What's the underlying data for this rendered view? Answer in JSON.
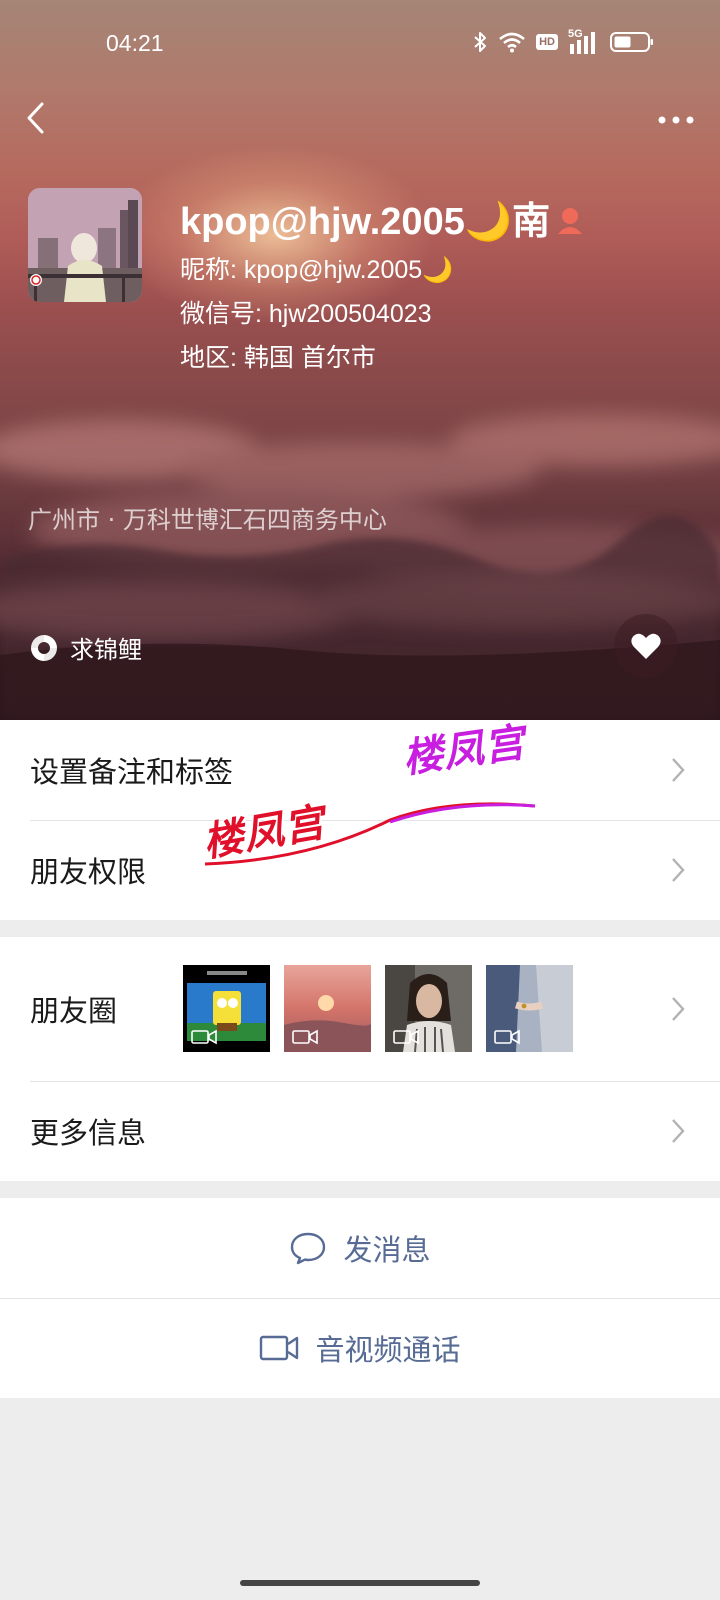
{
  "status_bar": {
    "time": "04:21",
    "hd_label": "HD",
    "network_label": "5G"
  },
  "profile": {
    "display_name": "kpop@hjw.2005🌙南",
    "nickname_line": "昵称: kpop@hjw.2005🌙",
    "wechat_id_line": "微信号: hjw200504023",
    "region_line": "地区: 韩国  首尔市",
    "location": "广州市 · 万科世博汇石四商务中心",
    "status_text": "求锦鲤"
  },
  "menu": {
    "remark_tags": "设置备注和标签",
    "friend_permissions": "朋友权限",
    "moments": "朋友圈",
    "more_info": "更多信息"
  },
  "actions": {
    "send_message": "发消息",
    "video_call": "音视频通话"
  },
  "watermark": {
    "text_left": "楼凤宫",
    "text_right": "楼凤宫"
  },
  "colors": {
    "link_blue": "#576b95",
    "watermark_red": "#e0102a",
    "watermark_purple": "#c81ee0",
    "gender_red": "#f06a5a"
  },
  "icons": [
    "back-arrow-icon",
    "more-dots-icon",
    "bluetooth-icon",
    "wifi-icon",
    "signal-icon",
    "battery-icon",
    "koi-status-icon",
    "heart-icon",
    "chevron-right-icon",
    "video-icon",
    "chat-bubble-icon",
    "video-call-icon",
    "female-gender-icon"
  ]
}
